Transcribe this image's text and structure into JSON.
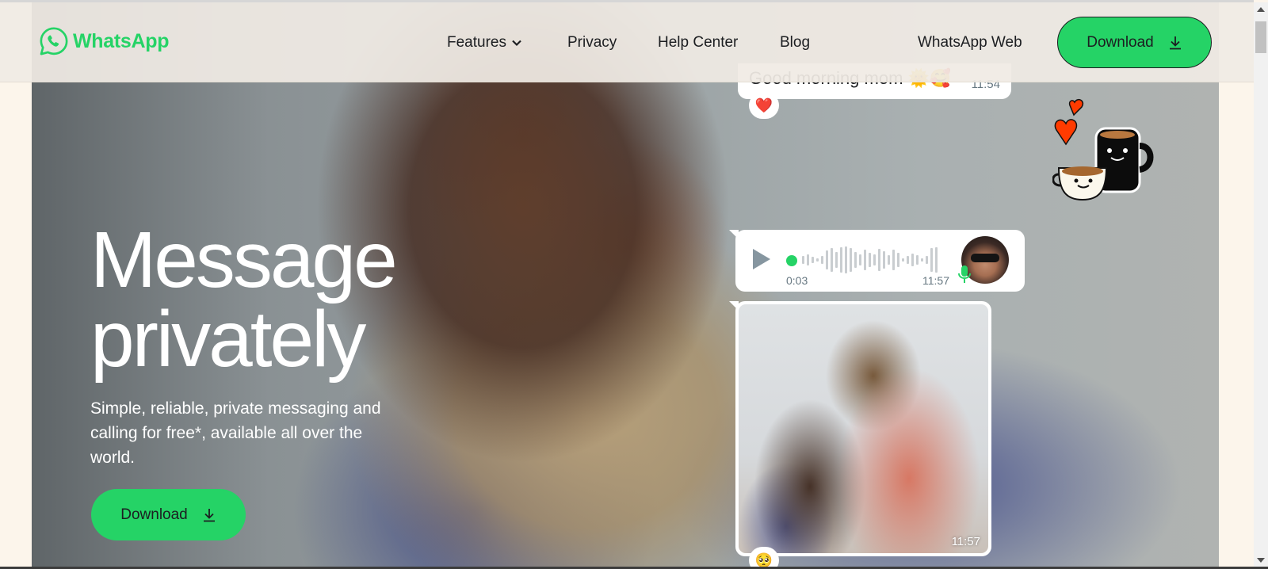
{
  "header": {
    "brand": "WhatsApp",
    "nav": [
      {
        "label": "Features",
        "has_dropdown": true
      },
      {
        "label": "Privacy"
      },
      {
        "label": "Help Center"
      },
      {
        "label": "Blog"
      }
    ],
    "web_link": "WhatsApp Web",
    "download_label": "Download"
  },
  "hero": {
    "headline_line1": "Message",
    "headline_line2": "privately",
    "subtext": "Simple, reliable, private messaging and calling for free*, available all over the world.",
    "download_label": "Download"
  },
  "chat": {
    "text_message": {
      "text": "Good morning mom 🌞🥰",
      "time": "11:54",
      "reaction": "❤️"
    },
    "voice_message": {
      "duration": "0:03",
      "time": "11:57",
      "progress": 0
    },
    "photo_message": {
      "time": "11:57",
      "reaction": "🥺"
    }
  },
  "colors": {
    "brand_green": "#25d366",
    "text_dark": "#1c1e21",
    "page_bg": "#fcf5eb",
    "timestamp_gray": "#667781"
  },
  "icons": {
    "logo": "whatsapp-logo-icon",
    "features_dropdown": "chevron-down-icon",
    "download": "download-icon",
    "play": "play-icon",
    "mic": "microphone-icon"
  }
}
